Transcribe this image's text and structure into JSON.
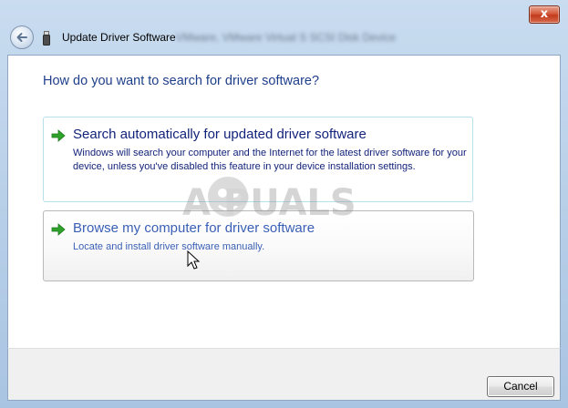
{
  "window": {
    "close_label": "x",
    "title": "Update Driver Software",
    "device_name": "VMware, VMware Virtual S SCSI Disk Device"
  },
  "heading": "How do you want to search for driver software?",
  "options": [
    {
      "title": "Search automatically for updated driver software",
      "description": "Windows will search your computer and the Internet for the latest driver software for your device, unless you've disabled this feature in your device installation settings."
    },
    {
      "title": "Browse my computer for driver software",
      "description": "Locate and install driver software manually."
    }
  ],
  "watermark": {
    "text": "A PUALS"
  },
  "footer": {
    "cancel_label": "Cancel"
  },
  "colors": {
    "heading": "#1e3f8a",
    "link_text": "#13237a",
    "hover_text": "#3a5fb5",
    "arrow": "#2fa22c"
  },
  "icons": {
    "back": "back-arrow-icon",
    "device": "usb-drive-icon",
    "option_arrow": "green-arrow-icon",
    "cursor": "mouse-pointer-icon"
  }
}
